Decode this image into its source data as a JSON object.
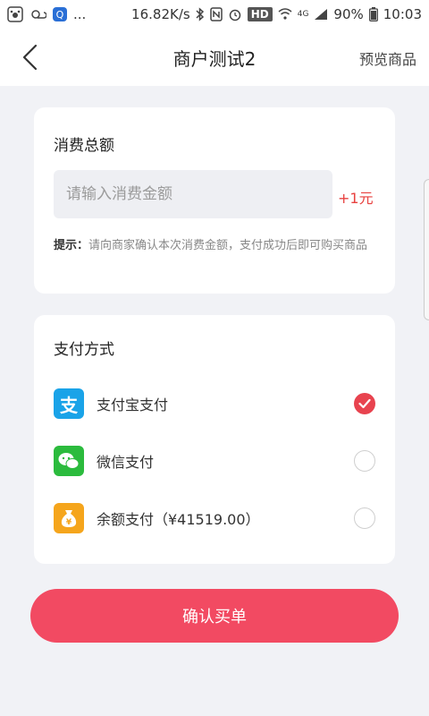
{
  "status_bar": {
    "dots": "...",
    "speed": "16.82K/s",
    "hd": "HD",
    "network": "4G",
    "battery": "90%",
    "time": "10:03"
  },
  "header": {
    "title": "商户测试2",
    "action": "预览商品"
  },
  "amount_card": {
    "title": "消费总额",
    "placeholder": "请输入消费金额",
    "unit": "+1元",
    "hint_label": "提示：",
    "hint_text": "请向商家确认本次消费金额，支付成功后即可购买商品"
  },
  "payment_card": {
    "title": "支付方式",
    "options": [
      {
        "label": "支付宝支付",
        "icon": "alipay-icon",
        "logo_char": "支",
        "color": "#1aa3e8",
        "selected": true
      },
      {
        "label": "微信支付",
        "icon": "wechat-icon",
        "color": "#2bbb3d",
        "selected": false
      },
      {
        "label": "余额支付（¥41519.00）",
        "icon": "wallet-icon",
        "logo_char": "¥",
        "color": "#f5a51c",
        "selected": false
      }
    ]
  },
  "confirm_button": "确认买单",
  "colors": {
    "accent": "#f24a62",
    "unit_red": "#e8413f",
    "background": "#f1f2f6"
  }
}
